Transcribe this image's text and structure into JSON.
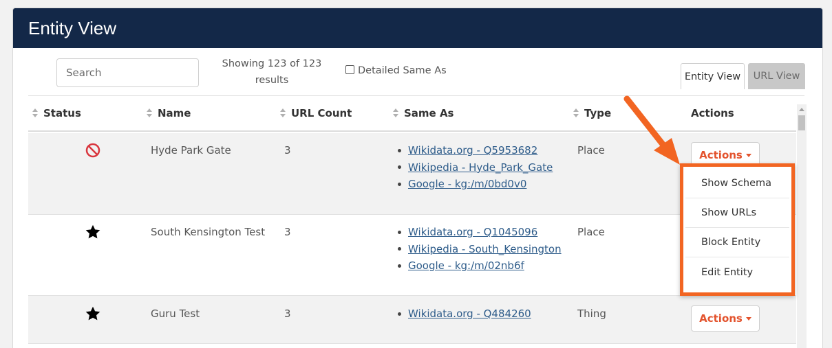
{
  "header": {
    "title": "Entity View"
  },
  "toolbar": {
    "search_placeholder": "Search",
    "showing_line1": "Showing 123 of 123",
    "showing_line2": "results",
    "detailed_label": "Detailed Same As",
    "view_tabs": [
      {
        "label": "Entity View",
        "active": true
      },
      {
        "label": "URL View",
        "active": false
      }
    ]
  },
  "table": {
    "columns": [
      "Status",
      "Name",
      "URL Count",
      "Same As",
      "Type",
      "Actions"
    ],
    "rows": [
      {
        "status_icon": "blocked-icon",
        "name": "Hyde Park Gate",
        "url_count": "3",
        "same_as": [
          "Wikidata.org - Q5953682",
          "Wikipedia - Hyde_Park_Gate",
          "Google - kg:/m/0bd0v0"
        ],
        "type": "Place",
        "actions_label": "Actions"
      },
      {
        "status_icon": "star-icon",
        "name": "South Kensington Test",
        "url_count": "3",
        "same_as": [
          "Wikidata.org - Q1045096",
          "Wikipedia - South_Kensington",
          "Google - kg:/m/02nb6f"
        ],
        "type": "Place"
      },
      {
        "status_icon": "star-icon",
        "name": "Guru Test",
        "url_count": "3",
        "same_as": [
          "Wikidata.org - Q484260"
        ],
        "type": "Thing",
        "actions_label": "Actions"
      }
    ]
  },
  "dropdown": {
    "items": [
      "Show Schema",
      "Show URLs",
      "Block Entity",
      "Edit Entity"
    ]
  },
  "colors": {
    "header_bg": "#132848",
    "accent": "#e3532d",
    "highlight": "#f26522",
    "link": "#2e5c8a"
  }
}
